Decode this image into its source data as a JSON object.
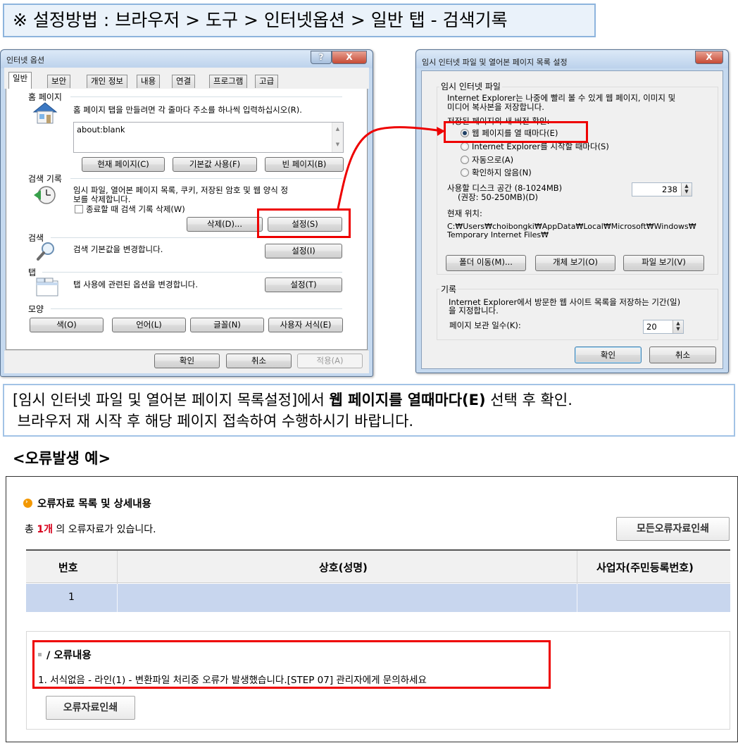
{
  "banner": {
    "text": "※ 설정방법 : 브라우저 > 도구 > 인터넷옵션 > 일반 탭 - 검색기록"
  },
  "inet_options": {
    "title": "인터넷 옵션",
    "help_btn": "?",
    "close_btn": "X",
    "tabs": [
      "일반",
      "보안",
      "개인 정보",
      "내용",
      "연결",
      "프로그램",
      "고급"
    ],
    "home": {
      "group": "홈 페이지",
      "desc": "홈 페이지 탭을 만들려면 각 줄마다 주소를 하나씩 입력하십시오(R).",
      "value": "about:blank",
      "btn_current": "현재 페이지(C)",
      "btn_default": "기본값 사용(F)",
      "btn_blank": "빈 페이지(B)"
    },
    "history": {
      "group": "검색 기록",
      "desc1": "임시 파일, 열어본 페이지 목록, 쿠키, 저장된 암호 및 웹 양식 정",
      "desc2": "보를 삭제합니다.",
      "check_label": "종료할 때 검색 기록 삭제(W)",
      "btn_delete": "삭제(D)...",
      "btn_settings": "설정(S)"
    },
    "search": {
      "group": "검색",
      "desc": "검색 기본값을 변경합니다.",
      "btn": "설정(I)"
    },
    "tabs_group": {
      "group": "탭",
      "desc": "탭 사용에 관련된 옵션을 변경합니다.",
      "btn": "설정(T)"
    },
    "appearance": {
      "group": "모양",
      "btn_color": "색(O)",
      "btn_lang": "언어(L)",
      "btn_font": "글꼴(N)",
      "btn_access": "사용자 서식(E)"
    },
    "btn_ok": "확인",
    "btn_cancel": "취소",
    "btn_apply": "적용(A)"
  },
  "temp_settings": {
    "title": "임시 인터넷 파일 및 열어본 페이지 목록 설정",
    "close_btn": "X",
    "temp_group": "임시 인터넷 파일",
    "desc1": "Internet Explorer는 나중에 빨리 볼 수 있게 웹 페이지, 이미지 및",
    "desc2": "미디어 복사본을 저장합니다.",
    "check_newer": "저장된 페이지의 새 버전 확인:",
    "radio_every_visit": "웹 페이지를 열 때마다(E)",
    "radio_every_start": "Internet Explorer를 시작할 때마다(S)",
    "radio_auto": "자동으로(A)",
    "radio_never": "확인하지 않음(N)",
    "disk_label1": "사용할 디스크 공간 (8-1024MB)",
    "disk_label2": "(권장: 50-250MB)(D)",
    "disk_value": "238",
    "location_label": "현재 위치:",
    "location_path1": "C:₩Users₩choibongki₩AppData₩Local₩Microsoft₩Windows₩",
    "location_path2": "Temporary Internet Files₩",
    "btn_move": "폴더 이동(M)...",
    "btn_objects": "개체 보기(O)",
    "btn_files": "파일 보기(V)",
    "history_group": "기록",
    "history_desc1": "Internet Explorer에서 방문한 웹 사이트 목록을 저장하는 기간(일)",
    "history_desc2": "을 지정합니다.",
    "days_label": "페이지 보관 일수(K):",
    "days_value": "20",
    "btn_ok": "확인",
    "btn_cancel": "취소"
  },
  "instruction": {
    "line1_pre": "[임시 인터넷 파일 및 열어본 페이지 목록설정]에서 ",
    "line1_bold": "웹 페이지를 열때마다(E)",
    "line1_post": " 선택 후 확인.",
    "line2": " 브라우저 재 시작 후 해당 페이지 접속하여 수행하시기 바랍니다."
  },
  "error_example": {
    "heading": "<오류발생 예>",
    "section_title": "오류자료 목록 및 상세내용",
    "count_pre": "총 ",
    "count_value": "1개",
    "count_post": " 의 오류자료가 있습니다.",
    "btn_print_all": "모든오류자료인쇄",
    "columns": [
      "번호",
      "상호(성명)",
      "사업자(주민등록번호)"
    ],
    "rows": [
      [
        "1",
        "",
        ""
      ]
    ],
    "detail_title": "/ 오류내용",
    "detail_msg": "1. 서식없음 - 라인(1) - 변환파일 처리중 오류가 발생했습니다.[STEP 07] 관리자에게 문의하세요",
    "btn_print": "오류자료인쇄"
  },
  "colors": {
    "accent_red": "#ee0000",
    "table_header": "#f1f1f1",
    "selected_row": "#c8d6ee",
    "bullet_orange": "#f39800"
  }
}
